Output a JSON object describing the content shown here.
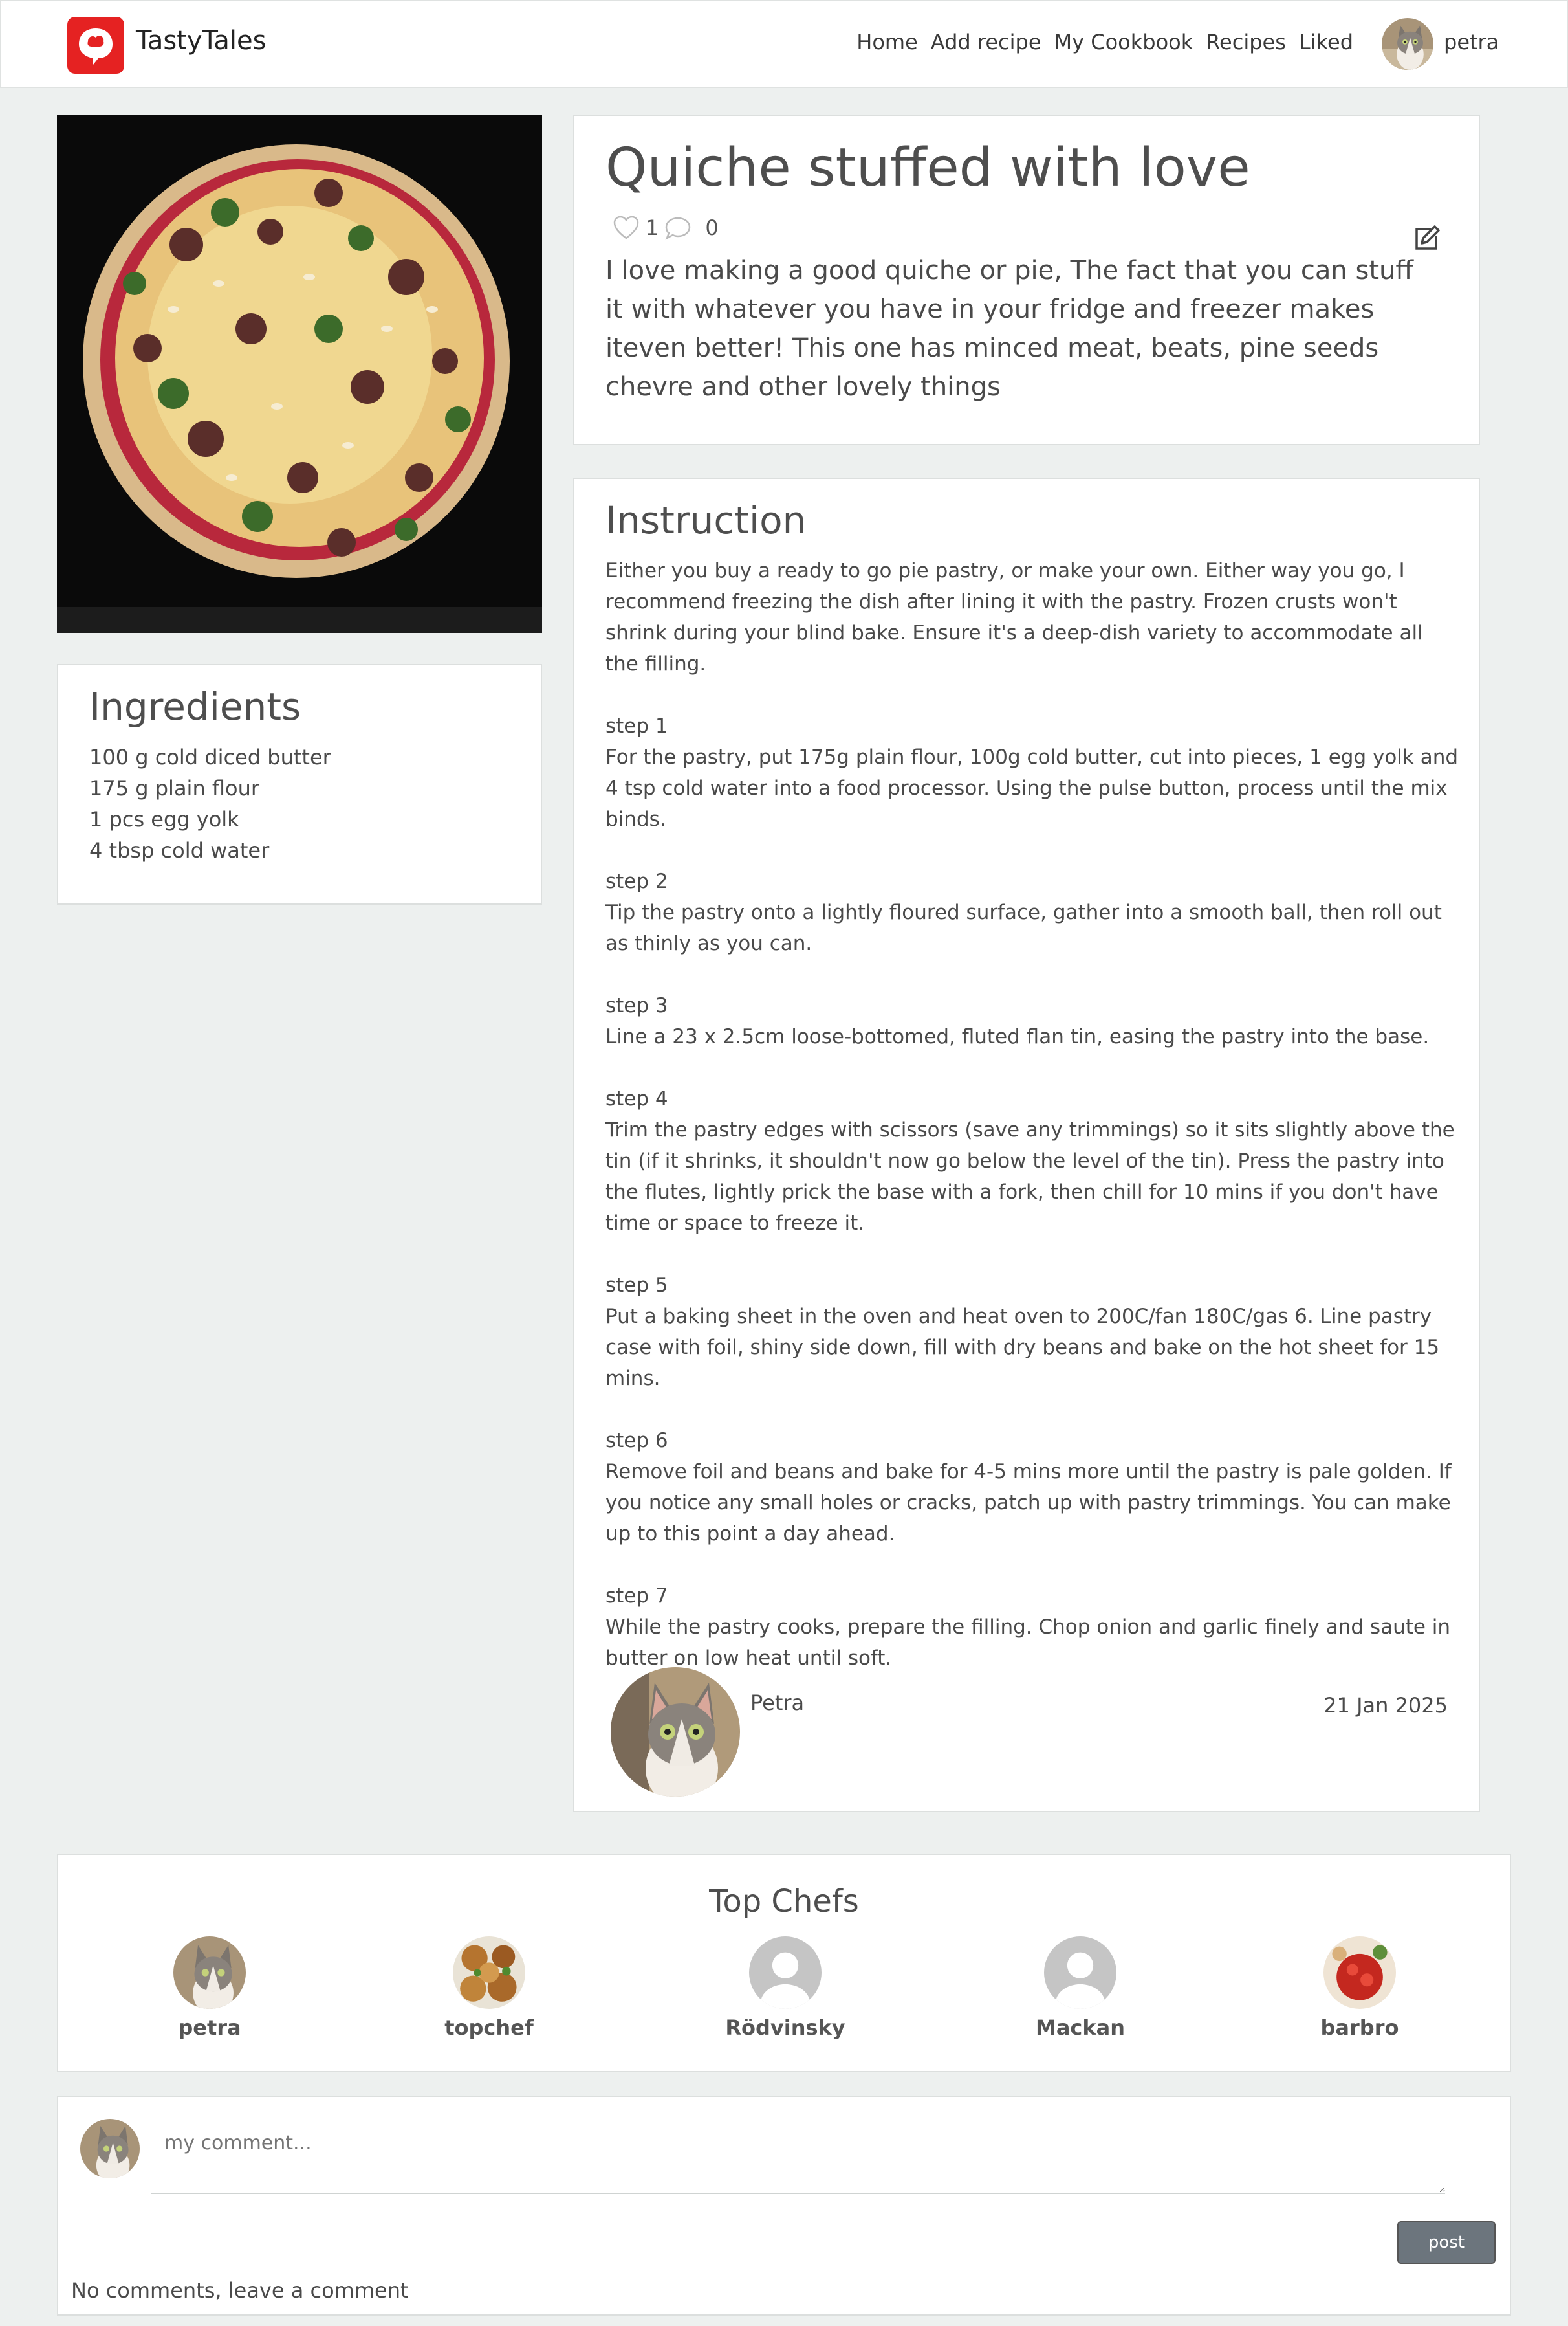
{
  "brand": {
    "name": "TastyTales",
    "logo_icon": "chef-hat-chat-icon",
    "color": "#e52222"
  },
  "nav": {
    "links": [
      "Home",
      "Add recipe",
      "My Cookbook",
      "Recipes",
      "Liked"
    ],
    "user": "petra"
  },
  "recipe": {
    "title": "Quiche stuffed with love",
    "likes": "1",
    "comments": "0",
    "description": "I love making a good quiche or pie, The fact that you can stuff it with whatever you have in your fridge and freezer makes iteven better! This one has minced meat, beats, pine seeds chevre and other lovely things"
  },
  "ingredients": {
    "title": "Ingredients",
    "items": [
      "100 g cold diced butter",
      "175 g plain flour",
      "1 pcs egg yolk",
      "4 tbsp cold water"
    ]
  },
  "instruction": {
    "title": "Instruction",
    "intro": "Either you buy a ready to go pie pastry, or make your own. Either way you go, I recommend   freezing the dish after lining it with the pastry. Frozen crusts won't shrink during your blind bake. Ensure it's a deep-dish variety to accommodate all the filling.",
    "steps": [
      {
        "label": "step 1",
        "text": "For the pastry, put 175g plain flour, 100g cold butter, cut into pieces, 1 egg yolk and 4 tsp cold water into a food processor. Using the pulse button, process until the mix binds."
      },
      {
        "label": "step 2",
        "text": "Tip the pastry onto a lightly floured surface, gather into a smooth ball, then roll out as thinly as you can."
      },
      {
        "label": "step 3",
        "text": "Line a 23 x 2.5cm loose-bottomed, fluted flan tin, easing the pastry into the base."
      },
      {
        "label": "step 4",
        "text": "Trim the pastry edges with scissors (save any trimmings) so it sits slightly above the tin (if it shrinks, it shouldn't now go below the level of the tin). Press the pastry into the flutes, lightly prick the base with a fork, then chill for 10 mins if you don't have time or space to freeze it."
      },
      {
        "label": "step 5",
        "text": "Put a baking sheet in the oven and heat oven to 200C/fan 180C/gas 6. Line pastry case with foil, shiny side down, fill with dry beans and bake on the hot sheet for 15 mins."
      },
      {
        "label": "step 6",
        "text": "Remove foil and beans and bake for 4-5 mins more until the pastry is pale golden. If you notice any small holes or cracks, patch up with pastry trimmings. You can make up to this point a day ahead."
      },
      {
        "label": "step 7",
        "text": "While the pastry cooks, prepare the filling. Chop onion and garlic finely and saute in butter on low heat until soft."
      }
    ],
    "author": "Petra",
    "date": "21 Jan 2025"
  },
  "top_chefs": {
    "title": "Top Chefs",
    "chefs": [
      {
        "name": "petra",
        "avatar": "cat-photo"
      },
      {
        "name": "topchef",
        "avatar": "food-photo"
      },
      {
        "name": "Rödvinsky",
        "avatar": "default-user-icon"
      },
      {
        "name": "Mackan",
        "avatar": "default-user-icon"
      },
      {
        "name": "barbro",
        "avatar": "tomato-photo"
      }
    ]
  },
  "comment_form": {
    "placeholder": "my comment...",
    "post_label": "post",
    "empty_text": "No comments, leave a comment"
  }
}
